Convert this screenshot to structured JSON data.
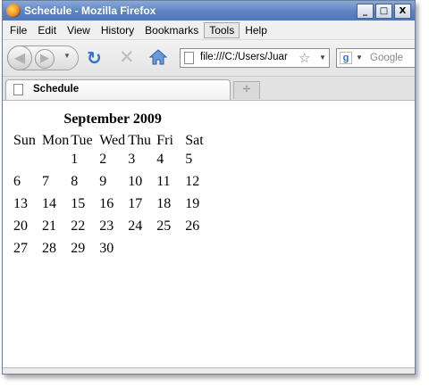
{
  "window": {
    "title": "Schedule - Mozilla Firefox"
  },
  "window_buttons": {
    "minimize": "_",
    "maximize": "□",
    "close": "X"
  },
  "menu": [
    "File",
    "Edit",
    "View",
    "History",
    "Bookmarks",
    "Tools",
    "Help"
  ],
  "active_menu": "Tools",
  "address": {
    "value": "file:///C:/Users/Juar"
  },
  "search": {
    "placeholder": "Google"
  },
  "tab": {
    "title": "Schedule"
  },
  "calendar": {
    "caption": "September 2009",
    "days": [
      "Sun",
      "Mon",
      "Tue",
      "Wed",
      "Thu",
      "Fri",
      "Sat"
    ],
    "weeks": [
      [
        "",
        "",
        "1",
        "2",
        "3",
        "4",
        "5"
      ],
      [
        "6",
        "7",
        "8",
        "9",
        "10",
        "11",
        "12"
      ],
      [
        "13",
        "14",
        "15",
        "16",
        "17",
        "18",
        "19"
      ],
      [
        "20",
        "21",
        "22",
        "23",
        "24",
        "25",
        "26"
      ],
      [
        "27",
        "28",
        "29",
        "30",
        "",
        "",
        ""
      ]
    ]
  }
}
